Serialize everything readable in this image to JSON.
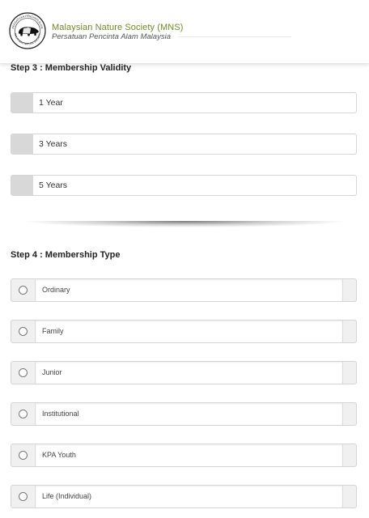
{
  "header": {
    "org_name": "Malaysian Nature Society (MNS)",
    "org_subtitle": "Persatuan Pencinta Alam Malaysia",
    "seal_text_top": "PERSATUAN PENCINTA ALAM",
    "seal_text_bottom": "MALAYSIAN NATURE SOCIETY",
    "logo_icon": "tapir-seal-icon"
  },
  "step3": {
    "title": "Step 3 : Membership Validity",
    "options": [
      {
        "label": "1 Year"
      },
      {
        "label": "3 Years"
      },
      {
        "label": "5 Years"
      }
    ]
  },
  "step4": {
    "title": "Step 4 : Membership Type",
    "options": [
      {
        "label": "Ordinary"
      },
      {
        "label": "Family"
      },
      {
        "label": "Junior"
      },
      {
        "label": "Institutional"
      },
      {
        "label": "KPA Youth"
      },
      {
        "label": "Life (Individual)"
      }
    ]
  },
  "colors": {
    "brand_green": "#6e8a1f",
    "addon_grey": "#d8d8d8"
  }
}
